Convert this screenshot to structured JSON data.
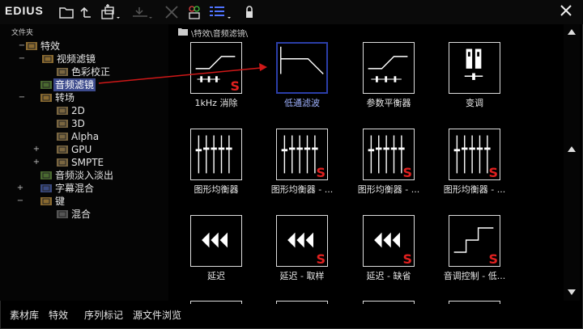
{
  "app": {
    "title": "EDIUS"
  },
  "tree": {
    "header": "文件夹",
    "items": [
      {
        "label": "特效",
        "toggle": "−"
      },
      {
        "label": "视频滤镜",
        "toggle": "−"
      },
      {
        "label": "色彩校正",
        "toggle": ""
      },
      {
        "label": "音频滤镜",
        "toggle": ""
      },
      {
        "label": "转场",
        "toggle": "−"
      },
      {
        "label": "2D",
        "toggle": ""
      },
      {
        "label": "3D",
        "toggle": ""
      },
      {
        "label": "Alpha",
        "toggle": ""
      },
      {
        "label": "GPU",
        "toggle": "+"
      },
      {
        "label": "SMPTE",
        "toggle": "+"
      },
      {
        "label": "音频淡入淡出",
        "toggle": ""
      },
      {
        "label": "字幕混合",
        "toggle": "+"
      },
      {
        "label": "键",
        "toggle": "−"
      },
      {
        "label": "混合",
        "toggle": ""
      }
    ]
  },
  "path": {
    "text": "\\特效\\音频滤镜\\"
  },
  "effects": [
    {
      "label": "1kHz 消除",
      "icon": "highpass-curve-icon",
      "badge": "S"
    },
    {
      "label": "低通滤波",
      "icon": "lowpass-curve-icon",
      "badge": ""
    },
    {
      "label": "参数平衡器",
      "icon": "parametric-eq-icon",
      "badge": ""
    },
    {
      "label": "变调",
      "icon": "pitch-shift-icon",
      "badge": ""
    },
    {
      "label": "图形均衡器",
      "icon": "graphic-eq-icon",
      "badge": ""
    },
    {
      "label": "图形均衡器 - ...",
      "icon": "graphic-eq-icon",
      "badge": "S"
    },
    {
      "label": "图形均衡器 - ...",
      "icon": "graphic-eq-icon",
      "badge": "S"
    },
    {
      "label": "图形均衡器 - ...",
      "icon": "graphic-eq-icon",
      "badge": "S"
    },
    {
      "label": "延迟",
      "icon": "delay-icon",
      "badge": ""
    },
    {
      "label": "延迟 - 取样",
      "icon": "delay-icon",
      "badge": "S"
    },
    {
      "label": "延迟 - 缺省",
      "icon": "delay-icon",
      "badge": "S"
    },
    {
      "label": "音调控制 - 低...",
      "icon": "tone-control-icon",
      "badge": "S"
    }
  ],
  "bottom_tabs": [
    "素材库",
    "特效",
    "序列标记",
    "源文件浏览"
  ],
  "colors": {
    "selection": "#3c4a8c",
    "badge": "#e0201f",
    "annotation_arrow": "#d01818",
    "folder": "#c8a040"
  }
}
